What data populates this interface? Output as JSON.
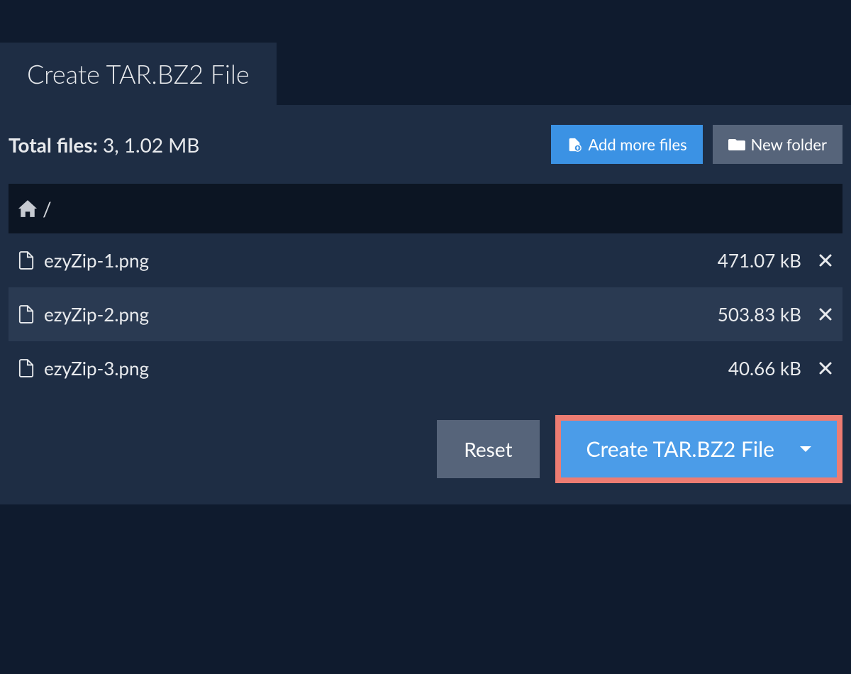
{
  "tab": {
    "title": "Create TAR.BZ2 File"
  },
  "summary": {
    "label": "Total files:",
    "value": "3, 1.02 MB"
  },
  "buttons": {
    "add_more": "Add more files",
    "new_folder": "New folder",
    "reset": "Reset",
    "create": "Create TAR.BZ2 File"
  },
  "breadcrumb": {
    "sep": "/"
  },
  "files": [
    {
      "name": "ezyZip-1.png",
      "size": "471.07 kB"
    },
    {
      "name": "ezyZip-2.png",
      "size": "503.83 kB"
    },
    {
      "name": "ezyZip-3.png",
      "size": "40.66 kB"
    }
  ]
}
